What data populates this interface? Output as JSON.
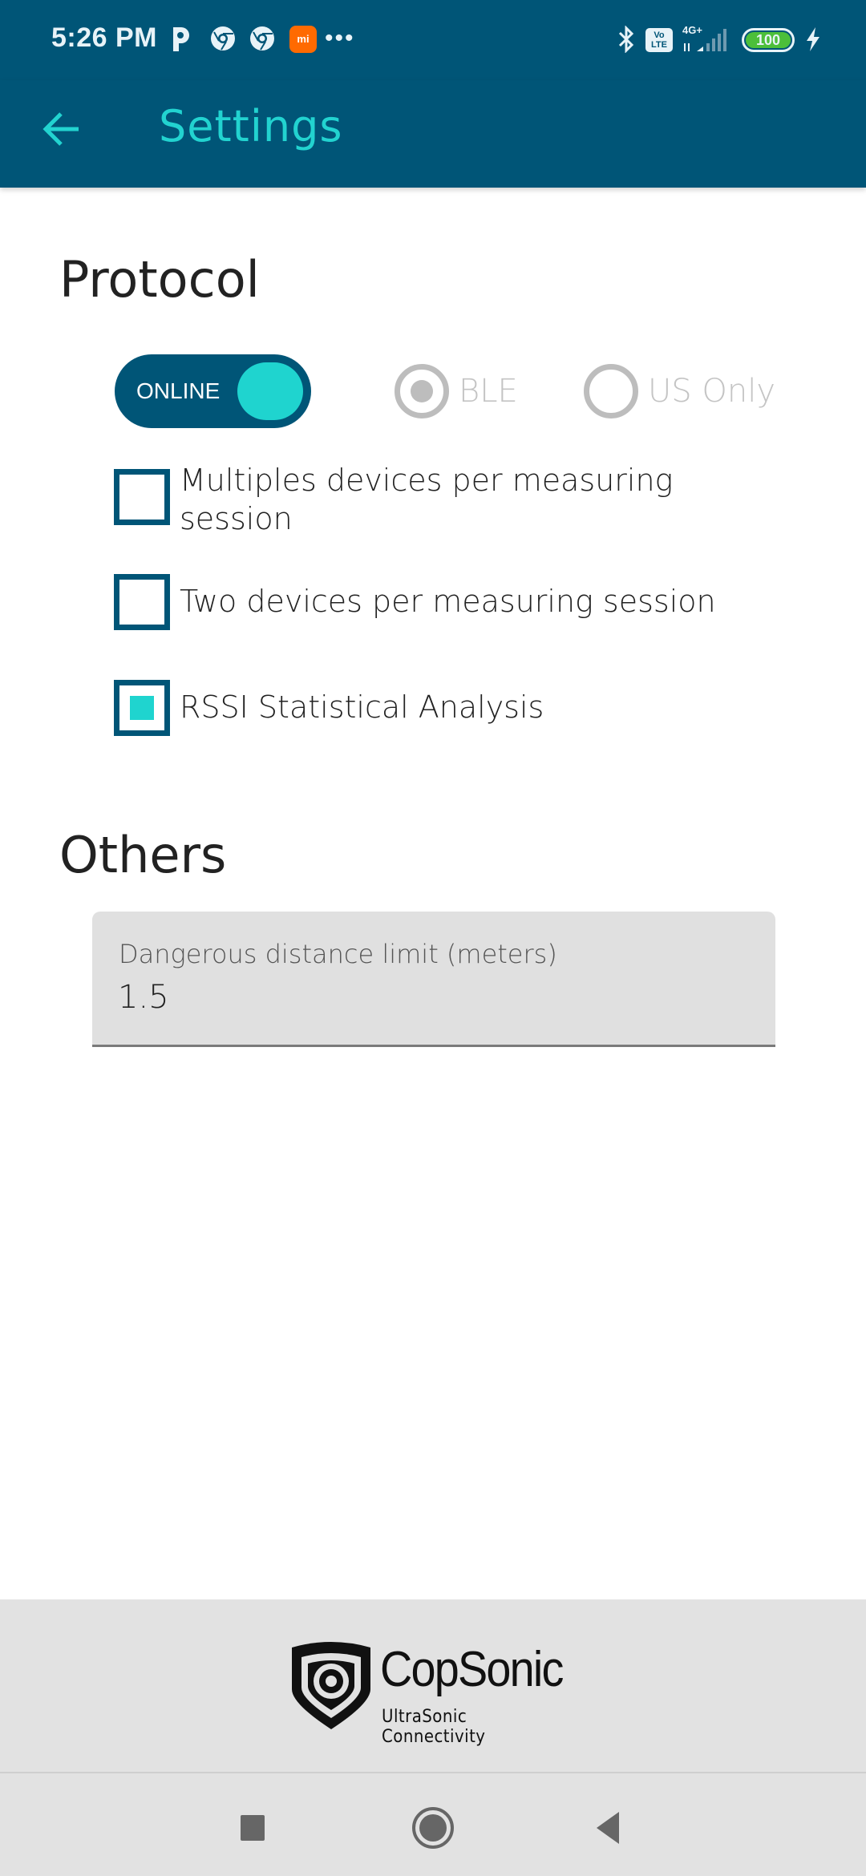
{
  "status_bar": {
    "time": "5:26 PM",
    "notification_icons": [
      "parking-app-icon",
      "chrome-icon",
      "chrome-icon",
      "mi-icon"
    ],
    "mi_label": "mi",
    "more_indicator": "•••",
    "volte_label": "Vo\nLTE",
    "network_type": "4G+",
    "battery_level": "100",
    "charging": true
  },
  "app_bar": {
    "title": "Settings",
    "back_icon": "arrow-left-icon"
  },
  "protocol": {
    "title": "Protocol",
    "toggle": {
      "label": "ONLINE",
      "on": true
    },
    "radio_options": [
      {
        "label": "BLE",
        "selected": true,
        "enabled": false
      },
      {
        "label": "US Only",
        "selected": false,
        "enabled": false
      }
    ],
    "checkboxes": [
      {
        "label": "Multiples devices per measuring session",
        "checked": false
      },
      {
        "label": "Two devices per measuring session",
        "checked": false
      },
      {
        "label": "RSSI Statistical Analysis",
        "checked": true
      }
    ]
  },
  "others": {
    "title": "Others",
    "distance_field": {
      "label": "Dangerous distance limit (meters)",
      "value": "1.5"
    }
  },
  "footer": {
    "brand": "CopSonic",
    "tagline": "UltraSonic Connectivity"
  },
  "nav_bar": {
    "buttons": [
      "recent-apps",
      "home",
      "back"
    ]
  },
  "colors": {
    "primary": "#005577",
    "accent": "#1fd4cf",
    "disabled": "#bdbdbd"
  }
}
